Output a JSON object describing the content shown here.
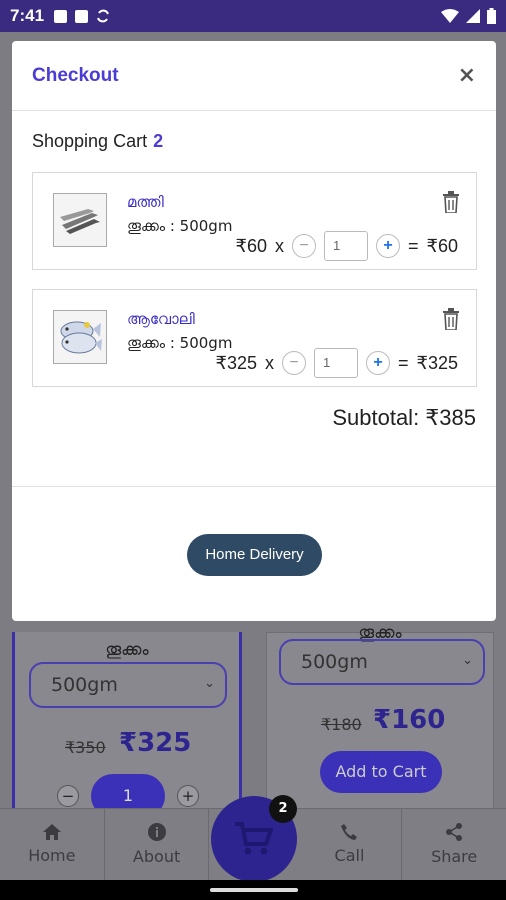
{
  "status_bar": {
    "time": "7:41"
  },
  "background": {
    "left_card": {
      "weight_label": "തൂക്കം",
      "weight_value": "500gm",
      "old_price": "₹350",
      "new_price": "₹325",
      "qty": "1",
      "minus": "−",
      "plus": "+"
    },
    "right_card": {
      "weight_label": "തൂക്കം",
      "weight_value": "500gm",
      "old_price": "₹180",
      "new_price": "₹160",
      "add_label": "Add to Cart"
    }
  },
  "bottom_nav": {
    "items": [
      {
        "label": "Home",
        "icon": "home-icon"
      },
      {
        "label": "About",
        "icon": "info-icon"
      },
      {
        "label": "Call",
        "icon": "phone-icon"
      },
      {
        "label": "Share",
        "icon": "share-icon"
      }
    ],
    "cart_badge": "2"
  },
  "modal": {
    "title": "Checkout",
    "close": "×",
    "cart_heading": "Shopping Cart",
    "cart_count": "2",
    "items": [
      {
        "name": "മത്തി",
        "weight": "തൂക്കം : 500gm",
        "unit_price": "₹60",
        "times": "x",
        "qty": "1",
        "equals": "=",
        "total": "₹60",
        "minus": "−",
        "plus": "+"
      },
      {
        "name": "ആവോലി",
        "weight": "തൂക്കം : 500gm",
        "unit_price": "₹325",
        "times": "x",
        "qty": "1",
        "equals": "=",
        "total": "₹325",
        "minus": "−",
        "plus": "+"
      }
    ],
    "subtotal": "Subtotal: ₹385",
    "delivery_button": "Home Delivery"
  },
  "colors": {
    "accent": "#4a3cd4",
    "status_bar": "#3a2a80",
    "delivery_button": "#2f4a64"
  }
}
